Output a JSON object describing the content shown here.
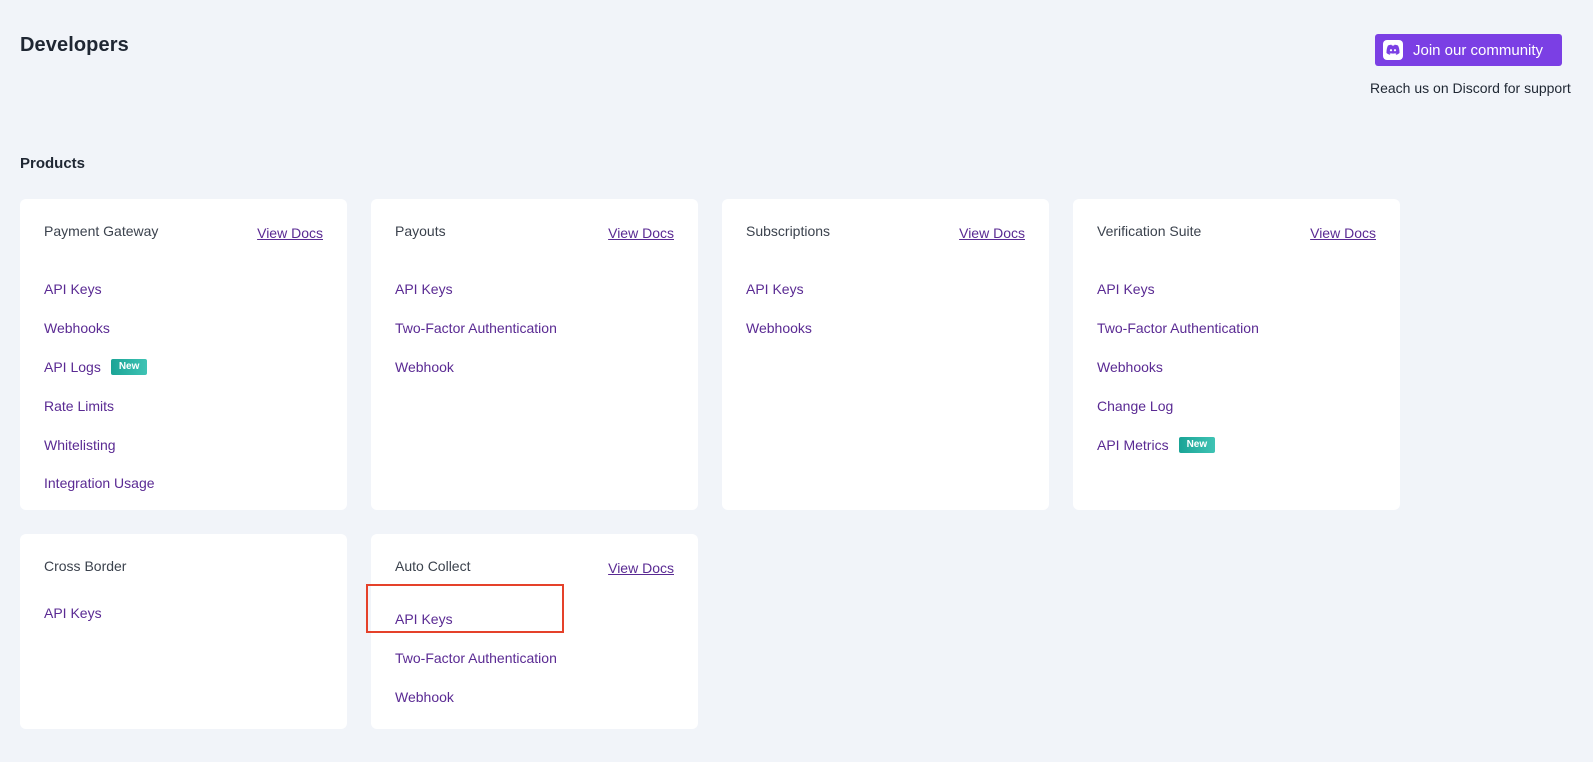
{
  "header": {
    "title": "Developers",
    "community_button": "Join our community",
    "community_sub": "Reach us on Discord for support",
    "community_icon": "discord-icon"
  },
  "section_title": "Products",
  "cards": [
    {
      "title": "Payment Gateway",
      "view_docs": "View Docs",
      "links": [
        {
          "label": "API Keys"
        },
        {
          "label": "Webhooks"
        },
        {
          "label": "API Logs",
          "badge": "New"
        },
        {
          "label": "Rate Limits"
        },
        {
          "label": "Whitelisting"
        },
        {
          "label": "Integration Usage"
        }
      ]
    },
    {
      "title": "Payouts",
      "view_docs": "View Docs",
      "links": [
        {
          "label": "API Keys"
        },
        {
          "label": "Two-Factor Authentication"
        },
        {
          "label": "Webhook"
        }
      ]
    },
    {
      "title": "Subscriptions",
      "view_docs": "View Docs",
      "links": [
        {
          "label": "API Keys"
        },
        {
          "label": "Webhooks"
        }
      ]
    },
    {
      "title": "Verification Suite",
      "view_docs": "View Docs",
      "links": [
        {
          "label": "API Keys"
        },
        {
          "label": "Two-Factor Authentication"
        },
        {
          "label": "Webhooks"
        },
        {
          "label": "Change Log"
        },
        {
          "label": "API Metrics",
          "badge": "New"
        }
      ]
    },
    {
      "title": "Cross Border",
      "links": [
        {
          "label": "API Keys"
        }
      ]
    },
    {
      "title": "Auto Collect",
      "view_docs": "View Docs",
      "links": [
        {
          "label": "API Keys"
        },
        {
          "label": "Two-Factor Authentication"
        },
        {
          "label": "Webhook"
        }
      ]
    }
  ],
  "colors": {
    "accent": "#7b3fe4",
    "link": "#5a2a93",
    "badge": "#1aa496",
    "highlight": "#e5412a",
    "background": "#f1f4f9"
  }
}
